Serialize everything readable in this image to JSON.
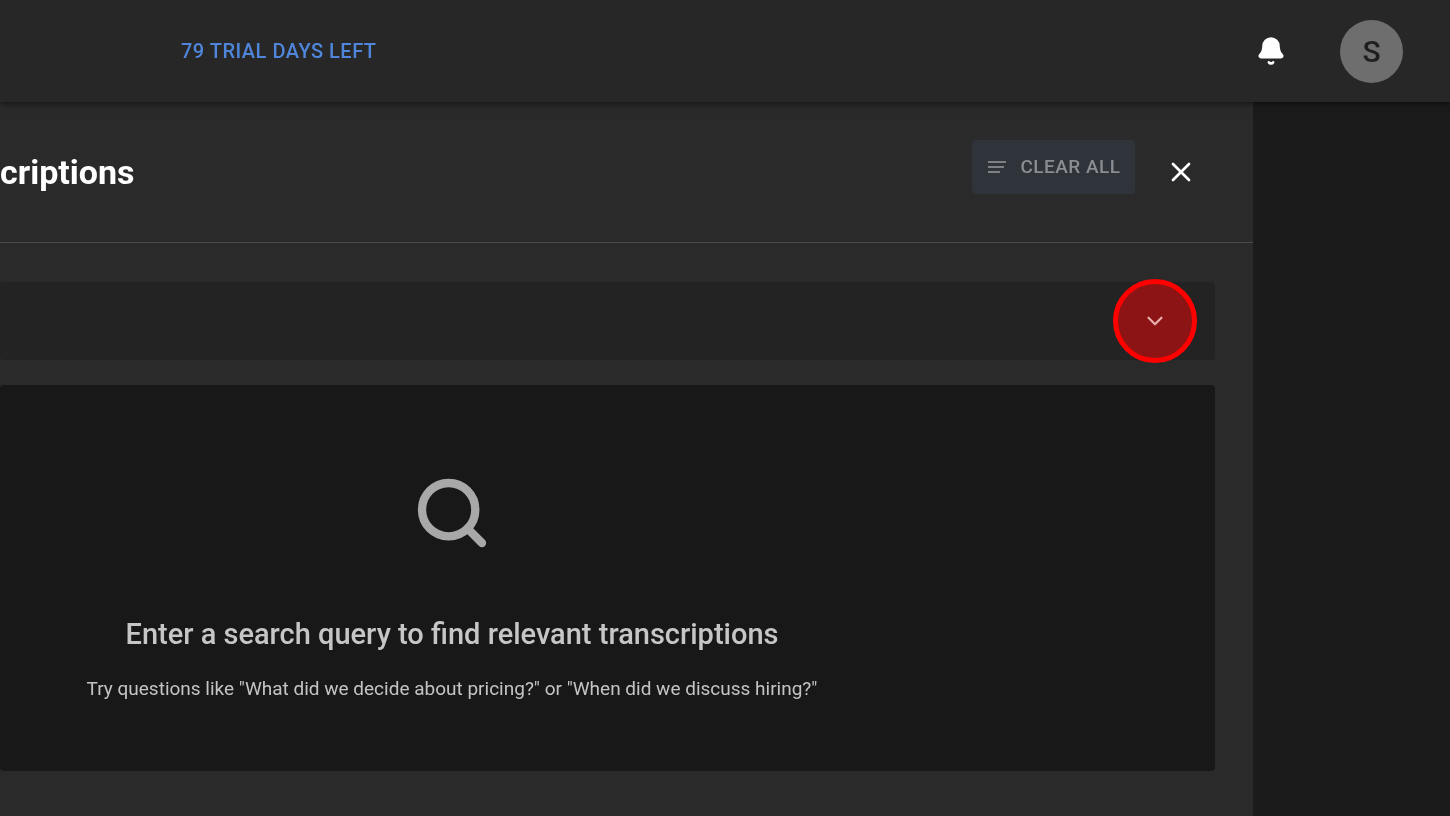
{
  "top_bar": {
    "trial": "79 TRIAL DAYS LEFT",
    "avatar": "S"
  },
  "panel": {
    "title": "criptions",
    "clear_button": "CLEAR ALL"
  },
  "search_row": {
    "expanded": false
  },
  "empty_state": {
    "heading": "Enter a search query to find relevant transcriptions",
    "hint": "Try questions like \"What did we decide about pricing?\" or \"When did we discuss hiring?\""
  }
}
